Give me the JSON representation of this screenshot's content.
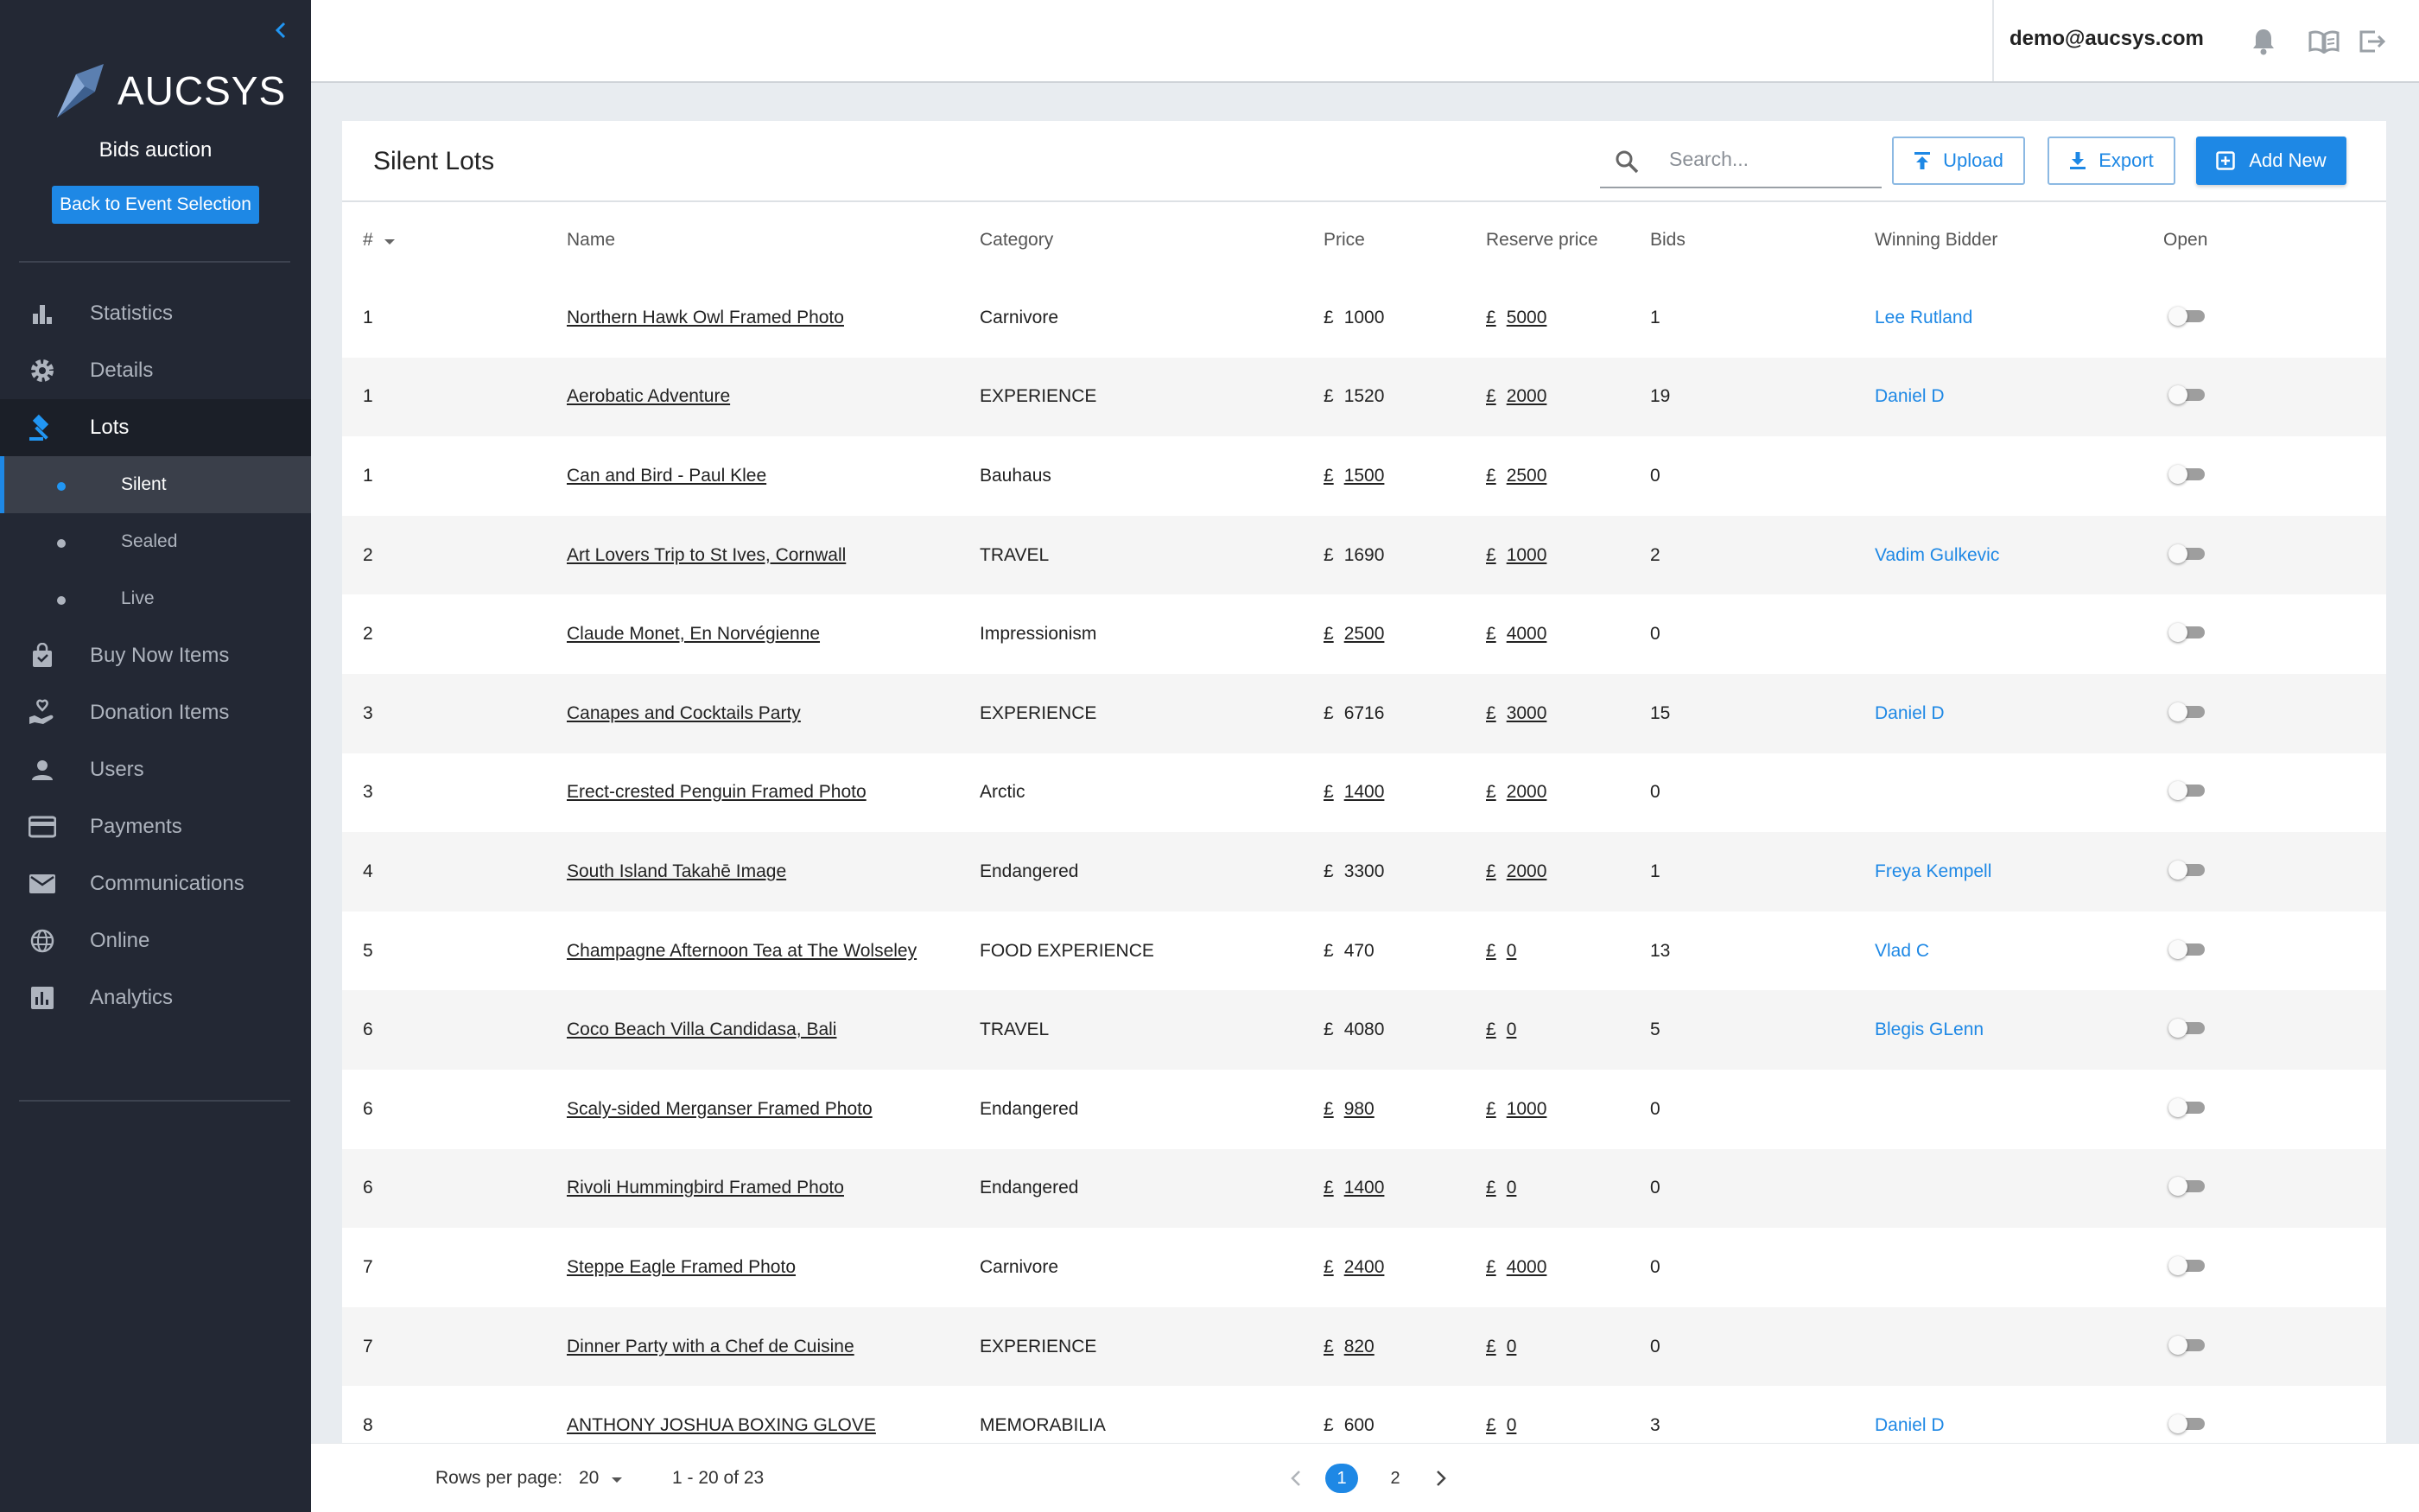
{
  "sidebar": {
    "brand": "AUCSYS",
    "event_name": "Bids auction",
    "back_label": "Back to Event Selection",
    "items": [
      {
        "label": "Statistics",
        "icon": "bar-chart-icon"
      },
      {
        "label": "Details",
        "icon": "gear-icon"
      },
      {
        "label": "Lots",
        "icon": "gavel-icon"
      },
      {
        "label": "Buy Now Items",
        "icon": "shopping-bag-icon"
      },
      {
        "label": "Donation Items",
        "icon": "donation-hand-icon"
      },
      {
        "label": "Users",
        "icon": "user-icon"
      },
      {
        "label": "Payments",
        "icon": "credit-card-icon"
      },
      {
        "label": "Communications",
        "icon": "mail-icon"
      },
      {
        "label": "Online",
        "icon": "globe-icon"
      },
      {
        "label": "Analytics",
        "icon": "analytics-icon"
      }
    ],
    "lots_sub": [
      {
        "label": "Silent",
        "active": true
      },
      {
        "label": "Sealed",
        "active": false
      },
      {
        "label": "Live",
        "active": false
      }
    ]
  },
  "topbar": {
    "user_email": "demo@aucsys.com"
  },
  "page": {
    "title": "Silent Lots",
    "search_placeholder": "Search...",
    "upload_label": "Upload",
    "export_label": "Export",
    "add_new_label": "Add New"
  },
  "table": {
    "columns": {
      "num": "#",
      "name": "Name",
      "category": "Category",
      "price": "Price",
      "reserve": "Reserve price",
      "bids": "Bids",
      "winner": "Winning Bidder",
      "open": "Open"
    },
    "currency": "£",
    "rows": [
      {
        "num": "1",
        "name": "Northern Hawk Owl Framed Photo",
        "category": "Carnivore",
        "price": "1000",
        "price_link": false,
        "reserve": "5000",
        "bids": "1",
        "winner": "Lee Rutland"
      },
      {
        "num": "1",
        "name": "Aerobatic Adventure",
        "category": "EXPERIENCE",
        "price": "1520",
        "price_link": false,
        "reserve": "2000",
        "bids": "19",
        "winner": "Daniel D"
      },
      {
        "num": "1",
        "name": "Can and Bird - Paul Klee",
        "category": "Bauhaus",
        "price": "1500",
        "price_link": true,
        "reserve": "2500",
        "bids": "0",
        "winner": ""
      },
      {
        "num": "2",
        "name": "Art Lovers Trip to St Ives, Cornwall",
        "category": "TRAVEL",
        "price": "1690",
        "price_link": false,
        "reserve": "1000",
        "bids": "2",
        "winner": "Vadim Gulkevic"
      },
      {
        "num": "2",
        "name": "Claude Monet, En Norvégienne",
        "category": "Impressionism",
        "price": "2500",
        "price_link": true,
        "reserve": "4000",
        "bids": "0",
        "winner": ""
      },
      {
        "num": "3",
        "name": "Canapes and Cocktails Party",
        "category": "EXPERIENCE",
        "price": "6716",
        "price_link": false,
        "reserve": "3000",
        "bids": "15",
        "winner": "Daniel D"
      },
      {
        "num": "3",
        "name": "Erect-crested Penguin Framed Photo",
        "category": "Arctic",
        "price": "1400",
        "price_link": true,
        "reserve": "2000",
        "bids": "0",
        "winner": ""
      },
      {
        "num": "4",
        "name": " South Island Takahē Image",
        "category": "Endangered",
        "price": "3300",
        "price_link": false,
        "reserve": "2000",
        "bids": "1",
        "winner": "Freya Kempell"
      },
      {
        "num": "5",
        "name": "Champagne Afternoon Tea at The Wolseley",
        "category": "FOOD EXPERIENCE",
        "price": "470",
        "price_link": false,
        "reserve": "0",
        "bids": "13",
        "winner": "Vlad C"
      },
      {
        "num": "6",
        "name": "Coco Beach Villa Candidasa, Bali",
        "category": "TRAVEL",
        "price": "4080",
        "price_link": false,
        "reserve": "0",
        "bids": "5",
        "winner": "Blegis GLenn"
      },
      {
        "num": "6",
        "name": "Scaly-sided Merganser Framed Photo",
        "category": "Endangered",
        "price": "980",
        "price_link": true,
        "reserve": "1000",
        "bids": "0",
        "winner": ""
      },
      {
        "num": "6",
        "name": "Rivoli Hummingbird Framed Photo",
        "category": "Endangered",
        "price": "1400",
        "price_link": true,
        "reserve": "0",
        "bids": "0",
        "winner": ""
      },
      {
        "num": "7",
        "name": "Steppe Eagle Framed Photo",
        "category": "Carnivore",
        "price": "2400",
        "price_link": true,
        "reserve": "4000",
        "bids": "0",
        "winner": ""
      },
      {
        "num": "7",
        "name": "Dinner Party with a Chef de Cuisine",
        "category": "EXPERIENCE",
        "price": "820",
        "price_link": true,
        "reserve": "0",
        "bids": "0",
        "winner": ""
      },
      {
        "num": "8",
        "name": "ANTHONY JOSHUA BOXING GLOVE",
        "category": "MEMORABILIA",
        "price": "600",
        "price_link": false,
        "reserve": "0",
        "bids": "3",
        "winner": "Daniel D"
      }
    ]
  },
  "footer": {
    "rows_per_page_label": "Rows per page:",
    "rows_per_page_value": "20",
    "range": "1 - 20 of 23",
    "pages": [
      "1",
      "2"
    ],
    "current_page": "1"
  },
  "colors": {
    "accent": "#1e88e5",
    "sidebar_bg": "#232834",
    "page_bg": "#e8ecf0"
  }
}
